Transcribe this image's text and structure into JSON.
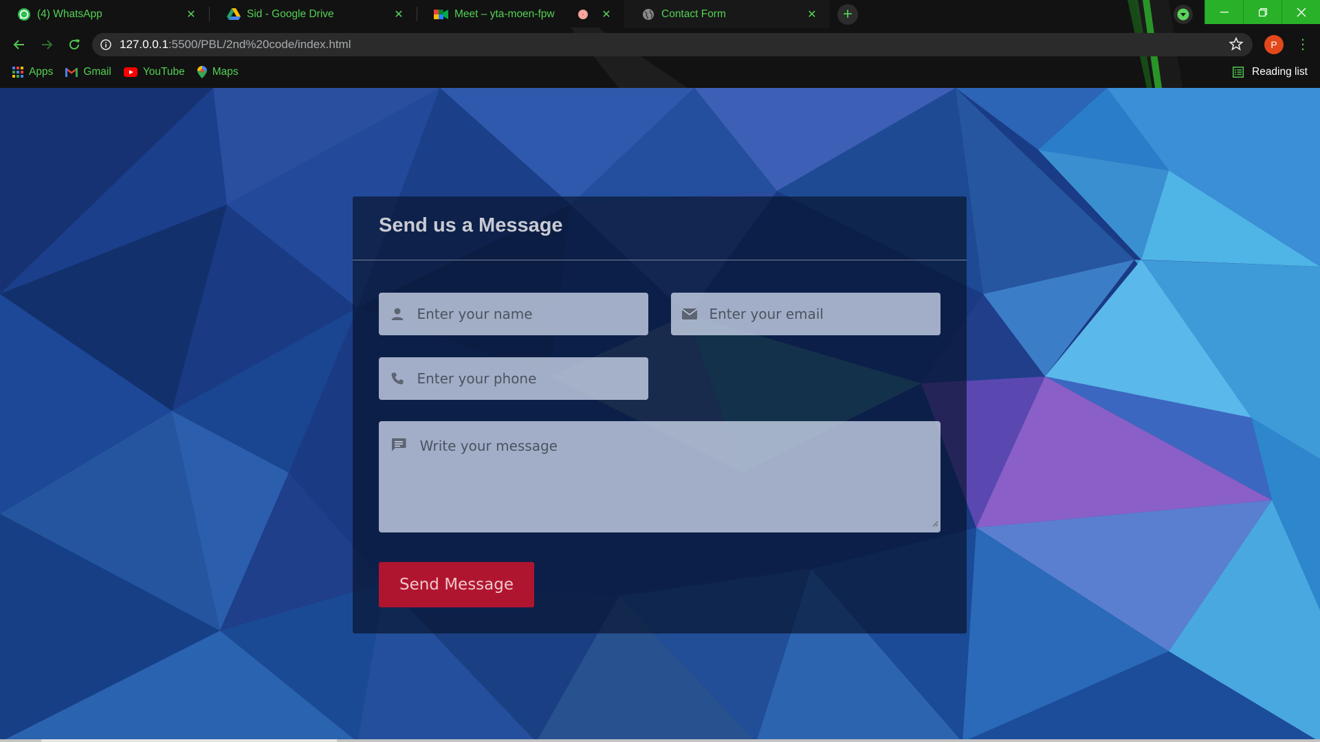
{
  "browser": {
    "tabs": [
      {
        "title": "(4) WhatsApp",
        "icon": "whatsapp-icon"
      },
      {
        "title": "Sid - Google Drive",
        "icon": "google-drive-icon"
      },
      {
        "title": "Meet – yta-moen-fpw",
        "icon": "google-meet-icon",
        "recording": true
      },
      {
        "title": "Contact Form",
        "icon": "globe-icon",
        "active": true
      }
    ],
    "url_host": "127.0.0.1",
    "url_path": ":5500/PBL/2nd%20code/index.html",
    "profile_initial": "P",
    "bookmarks": [
      {
        "label": "Apps",
        "icon": "apps-grid-icon"
      },
      {
        "label": "Gmail",
        "icon": "gmail-icon"
      },
      {
        "label": "YouTube",
        "icon": "youtube-icon"
      },
      {
        "label": "Maps",
        "icon": "maps-pin-icon"
      }
    ],
    "reading_list": "Reading list",
    "accent_color": "#54d154"
  },
  "form": {
    "title": "Send us a Message",
    "name_placeholder": "Enter your name",
    "email_placeholder": "Enter your email",
    "phone_placeholder": "Enter your phone",
    "message_placeholder": "Write your message",
    "submit_label": "Send Message",
    "submit_color": "#b01530"
  }
}
